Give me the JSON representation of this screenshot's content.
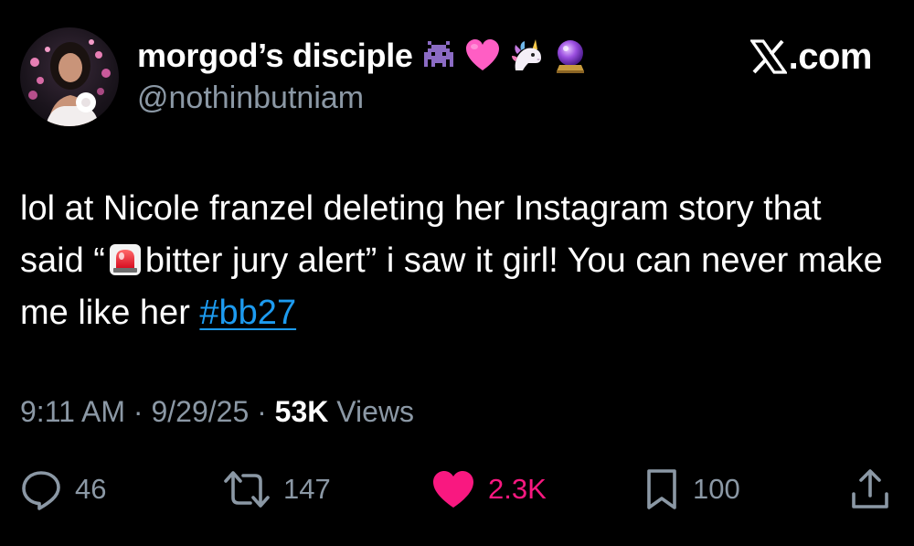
{
  "author": {
    "display_name": "morgod’s disciple",
    "name_emojis": [
      "alien-monster-icon",
      "pink-heart-icon",
      "unicorn-icon",
      "crystal-ball-icon"
    ],
    "handle": "@nothinbutniam"
  },
  "brand": {
    "domain": ".com",
    "logo": "x-logo-icon"
  },
  "tweet": {
    "text_part1": "lol at Nicole franzel deleting her Instagram story that said “",
    "emoji": "police-siren-icon",
    "text_part2": "bitter jury alert” i saw it girl! You can never make me like her ",
    "hashtag": "#bb27"
  },
  "meta": {
    "time": "9:11 AM",
    "separator": "·",
    "date": "9/29/25",
    "views_count": "53K",
    "views_label": "Views"
  },
  "actions": {
    "replies": "46",
    "reposts": "147",
    "likes": "2.3K",
    "bookmarks": "100"
  },
  "colors": {
    "background": "#000000",
    "text": "#ffffff",
    "secondary": "#8b98a5",
    "link": "#1d9bf0",
    "like": "#f91880"
  }
}
